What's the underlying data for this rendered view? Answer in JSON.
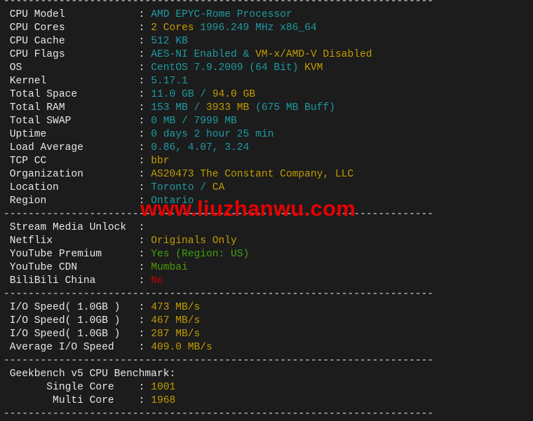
{
  "colors": {
    "label": "#e8e8e8",
    "teal": "#1e9aa2",
    "yellow": "#c19c00",
    "green": "#3fa00e",
    "darkgreen": "#4e9a06",
    "red": "#d00000",
    "background": "#1c1c1c"
  },
  "separator": "----------------------------------------------------------------------",
  "sections": [
    {
      "rows": [
        {
          "label": " CPU Model",
          "value": [
            {
              "t": "AMD EPYC-Rome Processor",
              "c": "teal"
            }
          ]
        },
        {
          "label": " CPU Cores",
          "value": [
            {
              "t": "2 Cores ",
              "c": "yellow"
            },
            {
              "t": "1996.249 MHz x86_64",
              "c": "teal"
            }
          ]
        },
        {
          "label": " CPU Cache",
          "value": [
            {
              "t": "512 KB",
              "c": "teal"
            }
          ]
        },
        {
          "label": " CPU Flags",
          "value": [
            {
              "t": "AES-NI Enabled & ",
              "c": "teal"
            },
            {
              "t": "VM-x/AMD-V Disabled",
              "c": "yellow"
            }
          ]
        },
        {
          "label": " OS",
          "value": [
            {
              "t": "CentOS 7.9.2009 (64 Bit) ",
              "c": "teal"
            },
            {
              "t": "KVM",
              "c": "yellow"
            }
          ]
        },
        {
          "label": " Kernel",
          "value": [
            {
              "t": "5.17.1",
              "c": "teal"
            }
          ]
        },
        {
          "label": " Total Space",
          "value": [
            {
              "t": "11.0 GB / ",
              "c": "teal"
            },
            {
              "t": "94.0 GB",
              "c": "yellow"
            }
          ]
        },
        {
          "label": " Total RAM",
          "value": [
            {
              "t": "153 MB / ",
              "c": "teal"
            },
            {
              "t": "3933 MB",
              "c": "yellow"
            },
            {
              "t": " (675 MB Buff)",
              "c": "teal"
            }
          ]
        },
        {
          "label": " Total SWAP",
          "value": [
            {
              "t": "0 MB / 7999 MB",
              "c": "teal"
            }
          ]
        },
        {
          "label": " Uptime",
          "value": [
            {
              "t": "0 days 2 hour 25 min",
              "c": "teal"
            }
          ]
        },
        {
          "label": " Load Average",
          "value": [
            {
              "t": "0.86, 4.07, 3.24",
              "c": "teal"
            }
          ]
        },
        {
          "label": " TCP CC",
          "value": [
            {
              "t": "bbr",
              "c": "yellow"
            }
          ]
        },
        {
          "label": " Organization",
          "value": [
            {
              "t": "AS20473 The Constant Company, LLC",
              "c": "yellow"
            }
          ]
        },
        {
          "label": " Location",
          "value": [
            {
              "t": "Toronto / ",
              "c": "teal"
            },
            {
              "t": "CA",
              "c": "yellow"
            }
          ]
        },
        {
          "label": " Region",
          "value": [
            {
              "t": "Ontario",
              "c": "teal"
            }
          ]
        }
      ]
    },
    {
      "rows": [
        {
          "label": " Stream Media Unlock",
          "value": []
        },
        {
          "label": " Netflix",
          "value": [
            {
              "t": "Originals Only",
              "c": "yellow"
            }
          ]
        },
        {
          "label": " YouTube Premium",
          "value": [
            {
              "t": "Yes (Region: US)",
              "c": "green"
            }
          ]
        },
        {
          "label": " YouTube CDN",
          "value": [
            {
              "t": "Mumbai",
              "c": "darkgreen"
            }
          ]
        },
        {
          "label": " BiliBili China",
          "value": [
            {
              "t": "No",
              "c": "red"
            }
          ]
        }
      ]
    },
    {
      "rows": [
        {
          "label": " I/O Speed( 1.0GB )",
          "value": [
            {
              "t": "473 MB/s",
              "c": "yellow"
            }
          ]
        },
        {
          "label": " I/O Speed( 1.0GB )",
          "value": [
            {
              "t": "467 MB/s",
              "c": "yellow"
            }
          ]
        },
        {
          "label": " I/O Speed( 1.0GB )",
          "value": [
            {
              "t": "287 MB/s",
              "c": "yellow"
            }
          ]
        },
        {
          "label": " Average I/O Speed",
          "value": [
            {
              "t": "409.0 MB/s",
              "c": "yellow"
            }
          ]
        }
      ]
    },
    {
      "rows": [
        {
          "label": " Geekbench v5 CPU Benchmark:",
          "plain": true,
          "value": []
        },
        {
          "label": "       Single Core",
          "value": [
            {
              "t": "1001",
              "c": "yellow"
            }
          ]
        },
        {
          "label": "        Multi Core",
          "value": [
            {
              "t": "1968",
              "c": "yellow"
            }
          ]
        }
      ]
    }
  ],
  "watermark": "www.liuzhanwu.com"
}
